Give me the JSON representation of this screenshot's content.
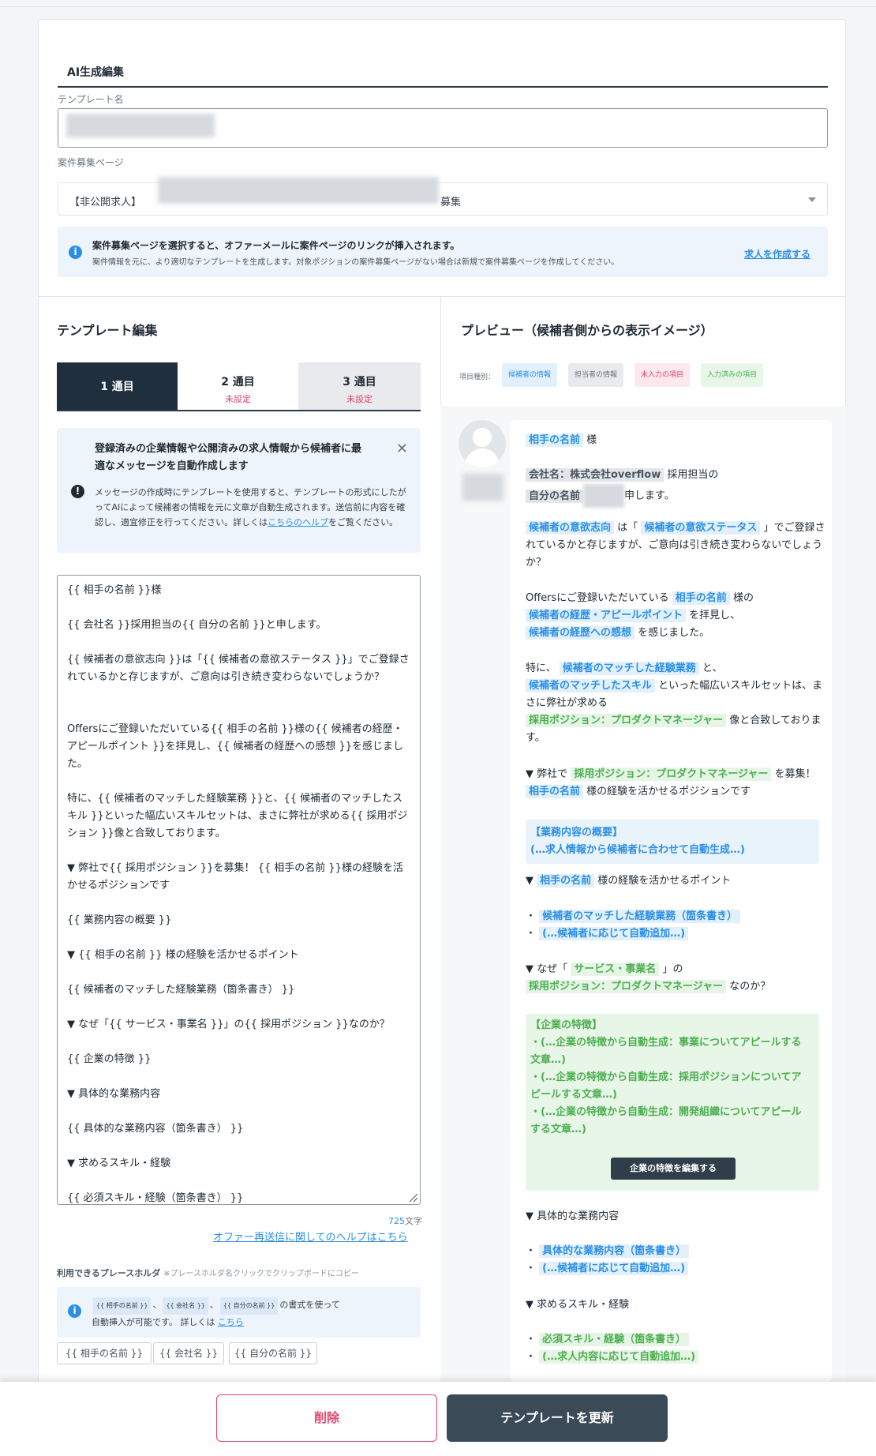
{
  "ai_section": {
    "title": "AI生成編集"
  },
  "template_name": {
    "label": "テンプレート名"
  },
  "job_page": {
    "label": "案件募集ページ",
    "value_prefix": "【非公開求人】",
    "value_suffix": "募集"
  },
  "job_info": {
    "title": "案件募集ページを選択すると、オファーメールに案件ページのリンクが挿入されます。",
    "body": "案件情報を元に、より適切なテンプレートを生成します。対象ポジションの案件募集ページがない場合は新規で案件募集ページを作成してください。",
    "link": "求人を作成する"
  },
  "editor_panel": {
    "title": "テンプレート編集",
    "tabs": [
      {
        "label": "1 通目",
        "sub": ""
      },
      {
        "label": "2 通目",
        "sub": "未設定"
      },
      {
        "label": "3 通目",
        "sub": "未設定"
      }
    ],
    "notice": {
      "heading": "登録済みの企業情報や公開済みの求人情報から候補者に最適なメッセージを自動作成します",
      "body_pre": "メッセージの作成時にテンプレートを使用すると、テンプレートの形式にしたがってAIによって候補者の情報を元に文章が自動生成されます。送信前に内容を確認し、適宜修正を行ってください。詳しくは",
      "body_link": "こちらのヘルプ",
      "body_post": "をご覧ください。",
      "close": "✕"
    },
    "editor_lines": [
      "{{ 相手の名前 }}様",
      "{{ 会社名 }}採用担当の{{ 自分の名前 }}と申します。",
      "{{ 候補者の意欲志向 }}は「{{ 候補者の意欲ステータス }}」でご登録されているかと存じますが、ご意向は引き続き変わらないでしょうか？",
      "Offersにご登録いただいている{{ 相手の名前 }}様の{{ 候補者の経歴・アピールポイント }}を拝見し、{{ 候補者の経歴への感想 }}を感じました。",
      "特に、{{ 候補者のマッチした経験業務 }}と、{{ 候補者のマッチしたスキル }}といった幅広いスキルセットは、まさに弊社が求める{{ 採用ポジション }}像と合致しております。",
      "▼ 弊社で{{ 採用ポジション }}を募集！ {{ 相手の名前 }}様の経験を活かせるポジションです",
      "{{ 業務内容の概要 }}",
      "▼ {{ 相手の名前 }} 様の経験を活かせるポイント",
      "{{ 候補者のマッチした経験業務（箇条書き） }}",
      "▼ なぜ「{{ サービス・事業名 }}」の{{ 採用ポジション }}なのか？",
      "{{ 企業の特徴 }}",
      "▼ 具体的な業務内容",
      "{{ 具体的な業務内容（箇条書き） }}",
      "▼ 求めるスキル・経験",
      "{{ 必須スキル・経験（箇条書き） }}"
    ],
    "char_count": "725",
    "char_unit": "文字",
    "help_link": "オファー再送信に関してのヘルプはこちら",
    "placeholder_label": "利用できるプレースホルダ",
    "placeholder_note": "※プレースホルダ名クリックでクリップボードにコピー",
    "placeholder_info": {
      "chips": [
        "{{ 相手の名前 }}",
        "{{ 会社名 }}",
        "{{ 自分の名前 }}"
      ],
      "sep": "、",
      "text1": "の書式を使って",
      "text2": "自動挿入が可能です。 詳しくは",
      "link": "こちら"
    },
    "placeholder_buttons": [
      "{{ 相手の名前 }}",
      "{{ 会社名 }}",
      "{{ 自分の名前 }}"
    ]
  },
  "preview_panel": {
    "title": "プレビュー（候補者側からの表示イメージ）",
    "legend_label": "項目種別：",
    "legend": [
      "候補者の情報",
      "担当者の情報",
      "未入力の項目",
      "入力済みの項目"
    ],
    "legend_colors": {
      "candidate": "#2b8fe6",
      "staff": "#6b7580",
      "empty": "#e0456b",
      "filled": "#4caf50"
    },
    "text": {
      "name": "相手の名前",
      "sama": "様",
      "company": "会社名：株式会社overflow",
      "hiring": "採用担当の",
      "myname": "自分の名前",
      "moushimasu": "申します。",
      "intent": "候補者の意欲志向",
      "ha_open": "は「",
      "intent_status": "候補者の意欲ステータス",
      "intent_rest": "」でご登録されているかと存じますが、ご意向は引き続き変わらないでしょうか？",
      "offers_pre": "Offersにご登録いただいている",
      "sama_no": "様の",
      "appeal": "候補者の経歴・アピールポイント",
      "haiken": "を拝見し、",
      "impression": "候補者の経歴への感想",
      "kanji": "を感じました。",
      "tokuni": "特に、",
      "exp": "候補者のマッチした経験業務",
      "to": "と、",
      "skill": "候補者のマッチしたスキル",
      "skillset": "といった幅広いスキルセットは、まさに弊社が求める",
      "position": "採用ポジション：プロダクトマネージャー",
      "gatchi": "像と合致しております。",
      "heisha": "▼ 弊社で",
      "boshu": "を募集！",
      "ikaseru": "様の経験を活かせるポジションです",
      "summary_1": "【業務内容の概要】",
      "summary_2": "(…求人情報から候補者に合わせて自動生成…)",
      "point_pre": "▼",
      "point_post": "様の経験を活かせるポイント",
      "bullet": "・",
      "exp_list": "候補者のマッチした経験業務（箇条書き）",
      "auto_add_candidate": "(…候補者に応じて自動追加…)",
      "naze": "▼ なぜ「",
      "service": "サービス・事業名",
      "no": "」の",
      "nanoka": "なのか？",
      "features_title": "【企業の特徴】",
      "features_1": "・(…企業の特徴から自動生成：事業についてアピールする文章…)",
      "features_2": "・(…企業の特徴から自動生成：採用ポジションについてアピールする文章…)",
      "features_3": "・(…企業の特徴から自動生成：開発組織についてアピールする文章…)",
      "features_button": "企業の特徴を編集する",
      "detail_title": "▼ 具体的な業務内容",
      "detail_list": "具体的な業務内容（箇条書き）",
      "skills_title": "▼ 求めるスキル・経験",
      "required": "必須スキル・経験（箇条書き）",
      "auto_add_job": "(…求人内容に応じて自動追加…)"
    }
  },
  "footer": {
    "delete": "削除",
    "update": "テンプレートを更新"
  }
}
